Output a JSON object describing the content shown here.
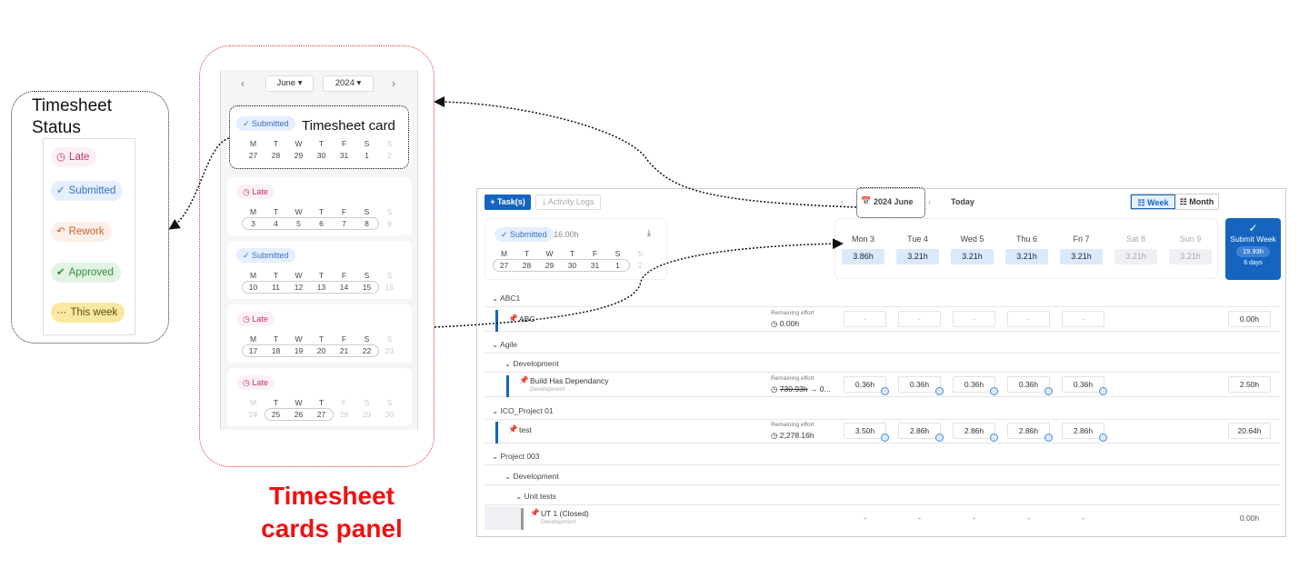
{
  "legend": {
    "title_line1": "Timesheet",
    "title_line2": "Status",
    "statuses": [
      {
        "icon": "clock-icon",
        "label": "Late"
      },
      {
        "icon": "check-icon",
        "label": "Submitted"
      },
      {
        "icon": "rework-icon",
        "label": "Rework"
      },
      {
        "icon": "approved-check-icon",
        "label": "Approved"
      },
      {
        "icon": "ellipsis-icon",
        "label": "This week"
      }
    ]
  },
  "panel": {
    "month": "June",
    "year": "2024",
    "card_label": "Timesheet card",
    "caption_line1": "Timesheet",
    "caption_line2": "cards panel",
    "weekday_letters": [
      "M",
      "T",
      "W",
      "T",
      "F",
      "S",
      "S"
    ],
    "cards": [
      {
        "status": "Submitted",
        "dates": [
          "27",
          "28",
          "29",
          "30",
          "31",
          "1",
          "2"
        ]
      },
      {
        "status": "Late",
        "dates": [
          "3",
          "4",
          "5",
          "6",
          "7",
          "8",
          "9"
        ]
      },
      {
        "status": "Submitted",
        "dates": [
          "10",
          "11",
          "12",
          "13",
          "14",
          "15",
          "16"
        ]
      },
      {
        "status": "Late",
        "dates": [
          "17",
          "18",
          "19",
          "20",
          "21",
          "22",
          "23"
        ]
      },
      {
        "status": "Late",
        "dates": [
          "24",
          "25",
          "26",
          "27",
          "28",
          "29",
          "30"
        ]
      }
    ]
  },
  "app": {
    "task_button": "Task(s)",
    "logs_button": "Activity Logs",
    "date_range": "2024 June",
    "today": "Today",
    "week_label": "Week",
    "month_label": "Month",
    "week_card": {
      "status": "Submitted",
      "hours": "16.00h",
      "weekday_letters": [
        "M",
        "T",
        "W",
        "T",
        "F",
        "S",
        "S"
      ],
      "dates": [
        "27",
        "28",
        "29",
        "30",
        "31",
        "1",
        "2"
      ]
    },
    "days": [
      {
        "name": "Mon 3",
        "hours": "3.86h"
      },
      {
        "name": "Tue 4",
        "hours": "3.21h"
      },
      {
        "name": "Wed 5",
        "hours": "3.21h"
      },
      {
        "name": "Thu 6",
        "hours": "3.21h"
      },
      {
        "name": "Fri 7",
        "hours": "3.21h"
      },
      {
        "name": "Sat 8",
        "hours": "3.21h"
      },
      {
        "name": "Sun 9",
        "hours": "3.21h"
      }
    ],
    "submit": {
      "label": "Submit Week",
      "total": "19.93h",
      "days": "6 days"
    },
    "rows": {
      "g1": "ABC1",
      "t1": {
        "name": "ABC",
        "rem_label": "Remaining effort",
        "rem_val": "0.00h",
        "cells": [
          "-",
          "-",
          "-",
          "-",
          "-"
        ],
        "total": "0.00h"
      },
      "g2": "Agile",
      "g2sub": "Development",
      "t2": {
        "name": "Build Has Dependancy",
        "sub": "Development",
        "rem_label": "Remaining effort",
        "rem_old": "730.93h",
        "rem_new": "0...",
        "cells": [
          "0.36h",
          "0.36h",
          "0.36h",
          "0.36h",
          "0.36h"
        ],
        "total": "2.50h"
      },
      "g3": "ICO_Project 01",
      "t3": {
        "name": "test",
        "rem_label": "Remaining effort",
        "rem_val": "2,278.16h",
        "cells": [
          "3.50h",
          "2.86h",
          "2.86h",
          "2.86h",
          "2.86h"
        ],
        "total": "20.64h"
      },
      "g4": "Project 003",
      "g4sub": "Development",
      "g4subsub": "Unit tests",
      "t4": {
        "name": "UT 1 (Closed)",
        "sub": "Development",
        "cells": [
          "-",
          "-",
          "-",
          "-",
          "-"
        ],
        "total": "0.00h"
      }
    }
  }
}
